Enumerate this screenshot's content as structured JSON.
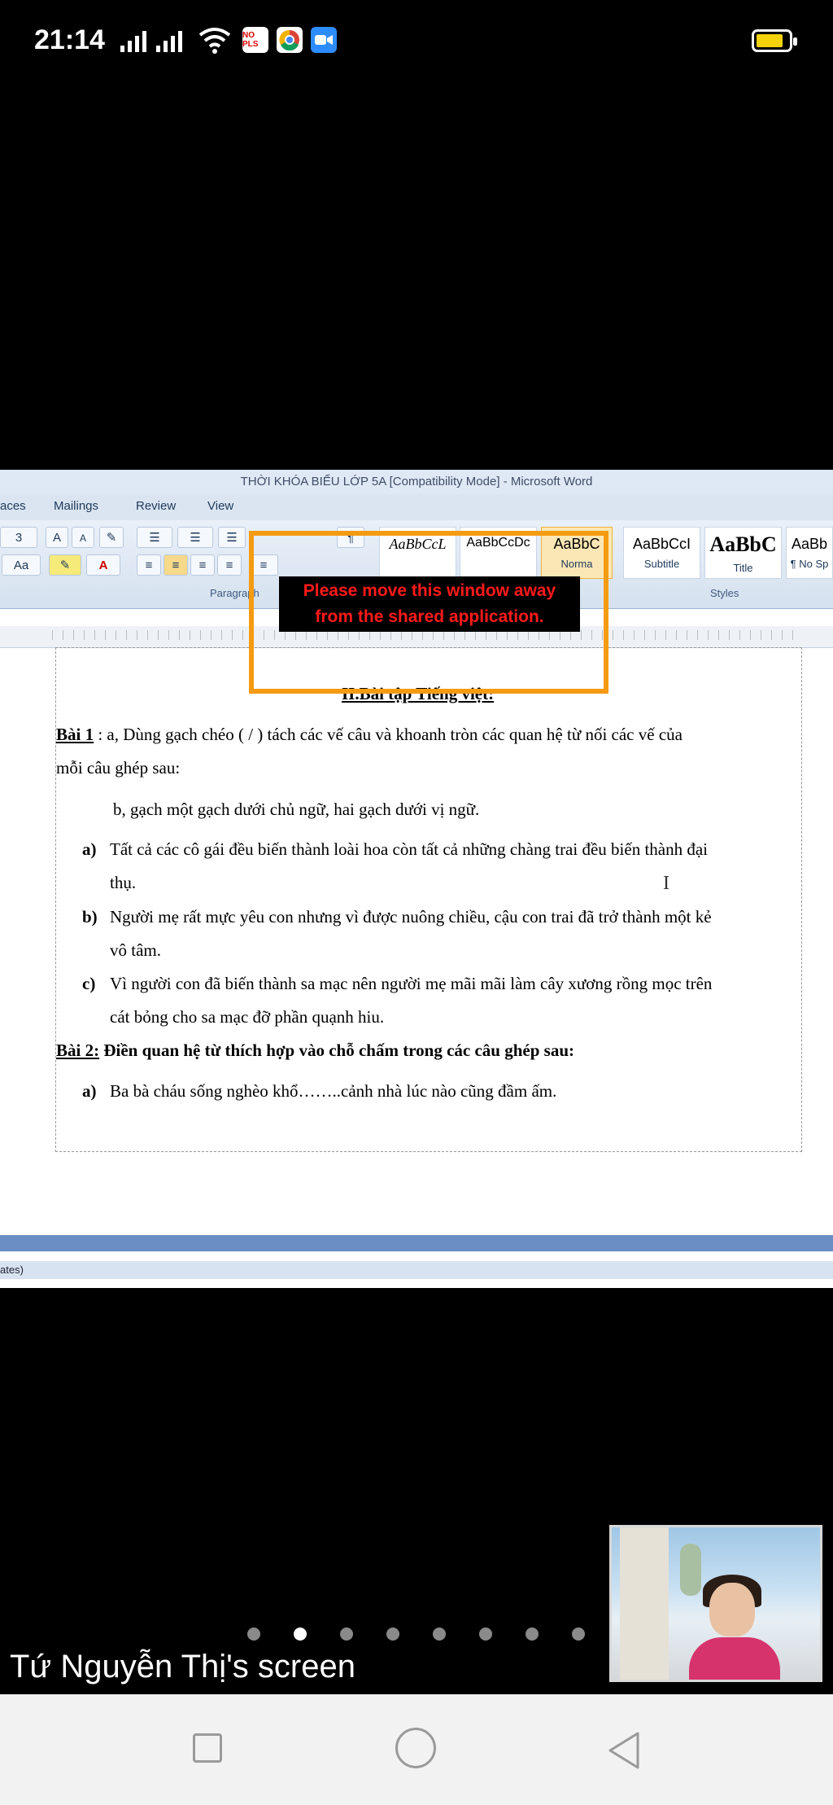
{
  "status": {
    "time": "21:14",
    "app_icon_news": "NO\nPLS"
  },
  "word": {
    "title": "THỜI KHÓA BIỂU LỚP 5A [Compatibility Mode] - Microsoft Word",
    "tabs": [
      "aces",
      "Mailings",
      "Review",
      "View"
    ],
    "font_size": "3",
    "paragraph_group": "Paragraph",
    "styles_group": "Styles",
    "styles": [
      {
        "sample": "AaBbCcL",
        "name": ""
      },
      {
        "sample": "AaBbCcDc",
        "name": ""
      },
      {
        "sample": "AaBbC",
        "name": "Norma"
      },
      {
        "sample": "AaBbCcI",
        "name": "Subtitle"
      },
      {
        "sample": "AaBbC",
        "name": "Title"
      },
      {
        "sample": "AaBb",
        "name": "¶ No Sp"
      }
    ],
    "status_fragment": "ates)"
  },
  "warning": {
    "line1": "Please move this window away",
    "line2": "from the shared application."
  },
  "document": {
    "heading": "II.Bài tập Tiếng việt:",
    "bai1_label": "Bài 1",
    "bai1_intro": " : a, Dùng gạch chéo ( / ) tách các vế câu và khoanh tròn các quan hệ từ nối các vế của",
    "bai1_intro2": "mỗi câu ghép sau:",
    "bai1_b": "b, gạch một gạch dưới chủ ngữ, hai gạch dưới vị ngữ.",
    "items": [
      {
        "marker": "a)",
        "line1": "Tất cả các cô gái đều biến thành loài hoa còn tất cả những chàng trai đều biến thành đại",
        "line2": "thụ."
      },
      {
        "marker": "b)",
        "line1": "Người mẹ rất mực yêu con nhưng vì được nuông chiều, cậu con trai  đã trở thành một kẻ",
        "line2": "vô tâm."
      },
      {
        "marker": "c)",
        "line1": "Vì người con đã biến thành sa mạc nên người mẹ mãi mãi làm cây xương rồng mọc trên",
        "line2": "cát bỏng cho sa mạc đỡ phần quạnh hiu."
      }
    ],
    "bai2_label": "Bài 2:",
    "bai2_text": " Điền quan hệ từ thích hợp vào chỗ chấm trong các câu ghép sau:",
    "bai2_item": {
      "marker": "a)",
      "text": "Ba bà cháu sống nghèo khổ……..cảnh nhà lúc nào cũng đầm ấm."
    }
  },
  "caption": "Tứ Nguyễn Thị's screen",
  "pager": {
    "count": 8,
    "active": 1
  }
}
